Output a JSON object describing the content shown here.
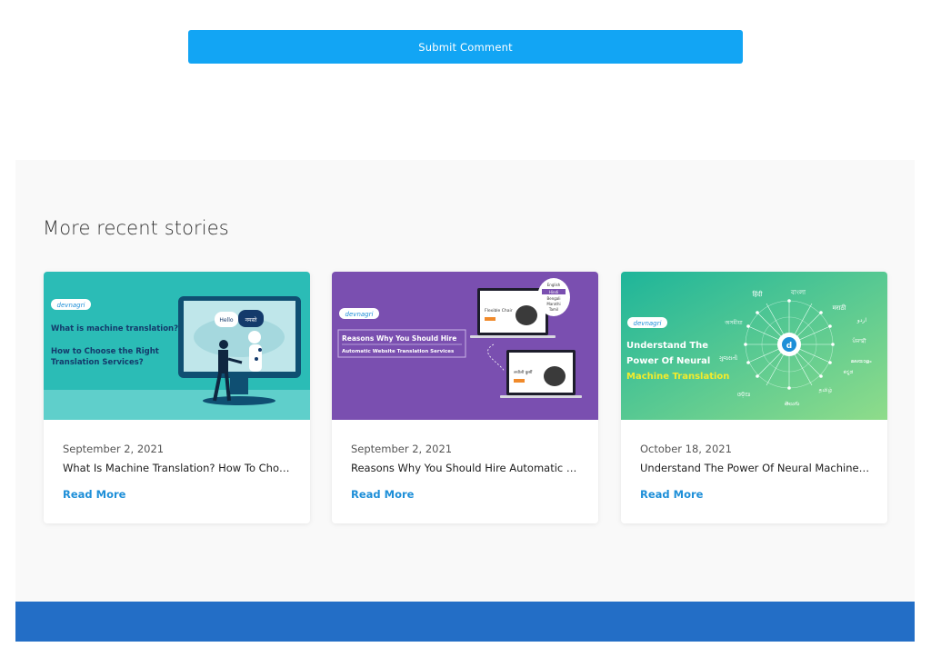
{
  "comment_form": {
    "submit_label": "Submit Comment"
  },
  "recent_stories": {
    "title": "More recent stories",
    "cards": [
      {
        "date": "September 2, 2021",
        "title": "What Is Machine Translation? How To Choose The Right Translation Services?",
        "link_label": "Read More",
        "thumbnail": {
          "logo_text": "devnagri",
          "heading": "What is machine translation?",
          "subheading_line1": "How to Choose the Right",
          "subheading_line2": "Translation Services?",
          "bubble_left": "Hello",
          "bubble_right": "नमस्ते",
          "bg_color": "#2bbcb6"
        }
      },
      {
        "date": "September 2, 2021",
        "title": "Reasons Why You Should Hire Automatic Website Translation Services",
        "link_label": "Read More",
        "thumbnail": {
          "logo_text": "devnagri",
          "heading": "Reasons Why You Should Hire",
          "subheading": "Automatic Website Translation Services",
          "product_en": "Flexible Chair",
          "product_hi": "लचीली कुर्सी",
          "languages": [
            "English",
            "Hindi",
            "Bengali",
            "Marathi",
            "Tamil"
          ],
          "bg_color": "#7a4fb0"
        }
      },
      {
        "date": "October 18, 2021",
        "title": "Understand The Power Of Neural Machine Translation",
        "link_label": "Read More",
        "thumbnail": {
          "logo_text": "devnagri",
          "heading_line1": "Understand The",
          "heading_line2": "Power Of Neural",
          "heading_line3": "Machine Translation",
          "languages": [
            "हिंदी",
            "বাংলা",
            "मराठी",
            "ਪੰਜਾਬੀ",
            "ಕನ್ನಡ",
            "தமிழ்",
            "ગુજરાતી",
            "తెలుగు",
            "ଓଡ଼ିଆ",
            "অসমীয়া",
            "اردو",
            "മലയാളം"
          ],
          "bg_color": "#2ec39a"
        }
      }
    ]
  },
  "colors": {
    "accent": "#12a5f4",
    "link": "#1e8fd8",
    "footer": "#236ec6",
    "section_bg": "#f9f9f9"
  }
}
